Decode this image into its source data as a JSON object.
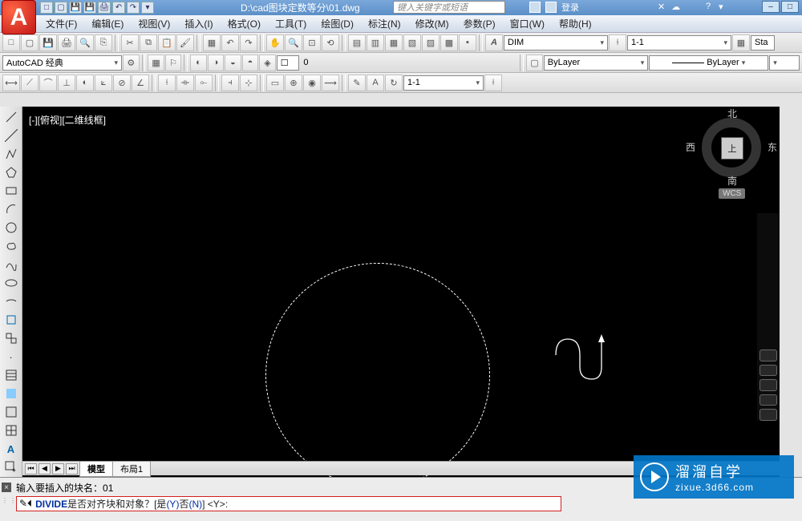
{
  "title": {
    "filename": "D:\\cad图块定数等分\\01.dwg"
  },
  "search": {
    "placeholder": "键入关键字或短语"
  },
  "login": {
    "label": "登录"
  },
  "winbtns": {
    "min": "–",
    "max": "□",
    "close": "×"
  },
  "menu": {
    "file": "文件(F)",
    "edit": "编辑(E)",
    "view": "视图(V)",
    "insert": "插入(I)",
    "format": "格式(O)",
    "tools": "工具(T)",
    "draw": "绘图(D)",
    "dimension": "标注(N)",
    "modify": "修改(M)",
    "param": "参数(P)",
    "window": "窗口(W)",
    "help": "帮助(H)"
  },
  "row2": {
    "workspace": "AutoCAD 经典",
    "layer0": "0"
  },
  "row1": {
    "textStyle": "DIM",
    "dimStyle": "1-1",
    "sta": "Sta"
  },
  "row3": {
    "layerCombo": "ByLayer",
    "ltCombo": "ByLayer",
    "scale": "1-1"
  },
  "viewport": {
    "label": "[-][俯视][二维线框]"
  },
  "compass": {
    "n": "北",
    "s": "南",
    "e": "东",
    "w": "西",
    "top": "上",
    "wcs": "WCS"
  },
  "tabs": {
    "model": "模型",
    "layout1": "布局1"
  },
  "cmd": {
    "line1_prefix": "输入要插入的块名：",
    "line1_val": "01",
    "line2_cmd": "DIVIDE",
    "line2_q": " 是否对齐块和对象？[",
    "line2_yes": "是(Y)",
    "line2_sep": " ",
    "line2_no": "否(N)",
    "line2_end": "] <Y>:"
  },
  "watermark": {
    "zh": "溜溜自学",
    "url": "zixue.3d66.com"
  }
}
